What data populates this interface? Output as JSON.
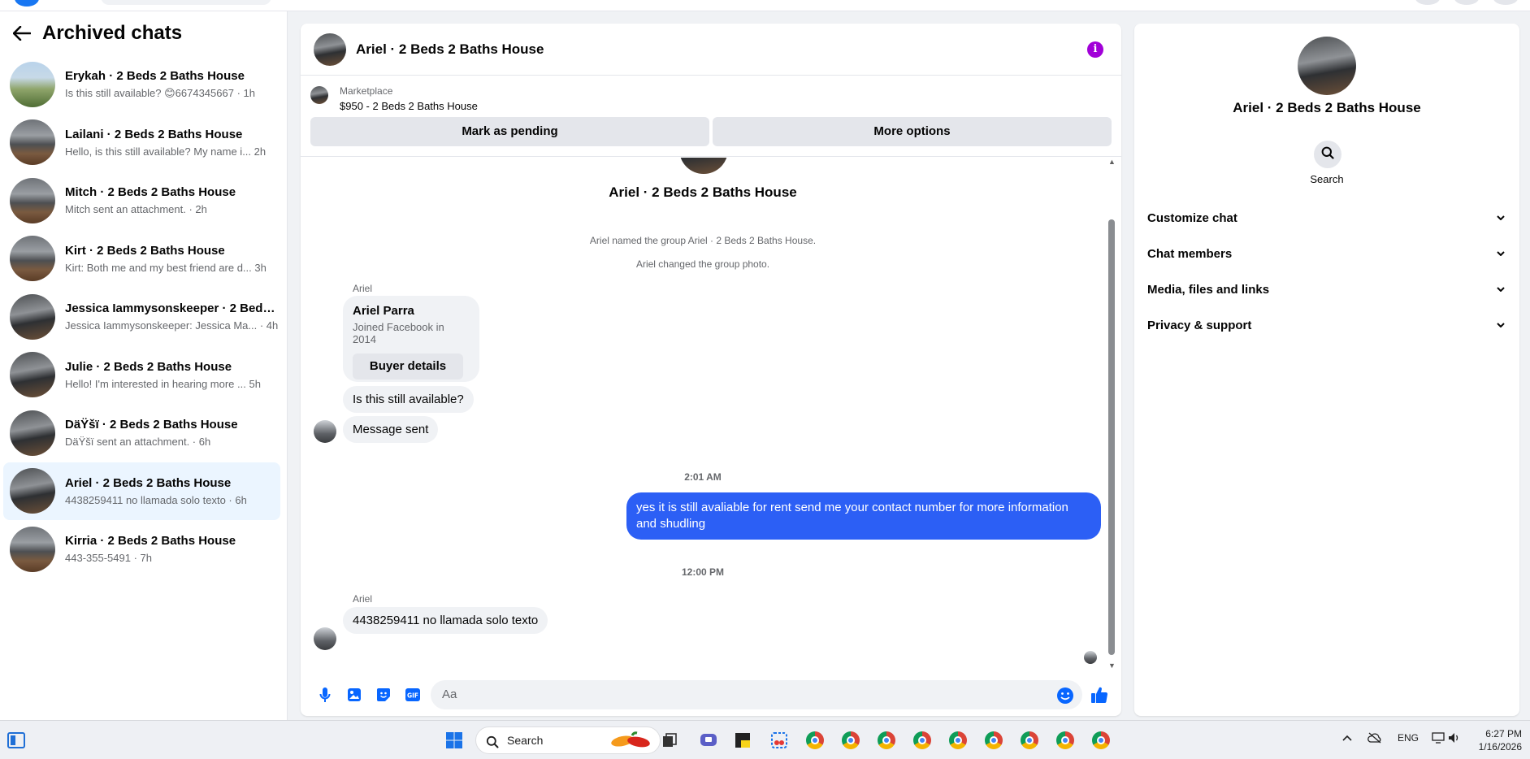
{
  "header": {
    "back_icon": "arrow-left-icon",
    "title": "Archived chats"
  },
  "chats": [
    {
      "name": "Erykah · 2 Beds 2 Baths House",
      "preview": "Is this still available? 😊6674345667 · 1h",
      "avatar": "house-exterior"
    },
    {
      "name": "Lailani · 2 Beds 2 Baths House",
      "preview": "Hello, is this still available? My name i...   2h",
      "avatar": "room"
    },
    {
      "name": "Mitch · 2 Beds 2 Baths House",
      "preview": "Mitch sent an attachment. · 2h",
      "avatar": "room"
    },
    {
      "name": "Kirt · 2 Beds 2 Baths House",
      "preview": "Kirt: Both me and my best friend are d...   3h",
      "avatar": "room"
    },
    {
      "name": "Jessica Iammysonskeeper · 2 Beds ...",
      "preview": "Jessica Iammysonskeeper: Jessica Ma... · 4h",
      "avatar": "room"
    },
    {
      "name": "Julie · 2 Beds 2 Baths House",
      "preview": "Hello! I'm interested in hearing more ...   5h",
      "avatar": "room"
    },
    {
      "name": "DäŸšï · 2 Beds 2 Baths House",
      "preview": "DäŸšï sent an attachment. · 6h",
      "avatar": "room"
    },
    {
      "name": "Ariel · 2 Beds 2 Baths House",
      "preview": "4438259411 no llamada solo texto · 6h",
      "avatar": "room",
      "active": true
    },
    {
      "name": "Kirria · 2 Beds 2 Baths House",
      "preview": "443-355-5491 · 7h",
      "avatar": "room"
    }
  ],
  "conversation": {
    "title": "Ariel · 2 Beds 2 Baths House",
    "info_icon": "info-icon",
    "marketplace_label": "Marketplace",
    "listing": "$950 - 2 Beds 2 Baths House",
    "mark_pending": "Mark as pending",
    "more_options": "More options",
    "group_name": "Ariel · 2 Beds 2 Baths House",
    "system_1": "Ariel named the group Ariel · 2 Beds 2 Baths House.",
    "system_2": "Ariel changed the group photo.",
    "sender_1": "Ariel",
    "card_name": "Ariel Parra",
    "card_sub": "Joined Facebook in 2014",
    "card_button": "Buyer details",
    "msg_1": "Is this still available?",
    "msg_2": "Message sent",
    "time_1": "2:01 AM",
    "out_msg": "yes it is still avaliable for rent send me your contact number for more information and shudling",
    "time_2": "12:00 PM",
    "sender_2": "Ariel",
    "msg_3": "4438259411 no llamada solo texto",
    "composer_placeholder": "Aa",
    "accent": "#2c5ff5"
  },
  "info": {
    "name": "Ariel · 2 Beds 2 Baths House",
    "search_label": "Search",
    "sections": [
      "Customize chat",
      "Chat members",
      "Media, files and links",
      "Privacy & support"
    ]
  },
  "taskbar": {
    "search_placeholder": "Search",
    "lang": "ENG",
    "time": "6:27 PM",
    "date": "1/16/2026"
  }
}
